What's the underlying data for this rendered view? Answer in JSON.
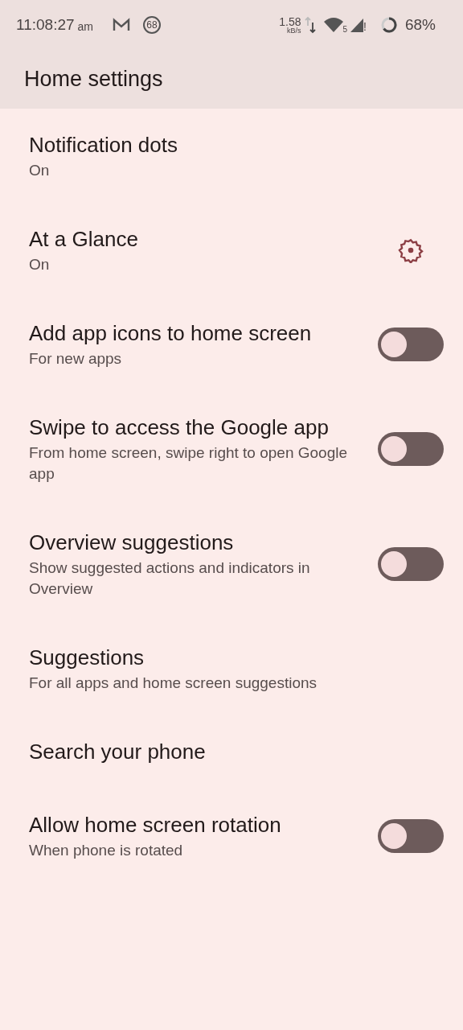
{
  "status_bar": {
    "time": "11:08:27",
    "ampm": "am",
    "notification_count": "68",
    "speed": "1.58",
    "speed_unit": "kB/s",
    "wifi_band": "5",
    "signal_alert": "!",
    "battery": "68%"
  },
  "header": {
    "title": "Home settings"
  },
  "items": [
    {
      "kind": "plain",
      "title": "Notification dots",
      "subtitle": "On"
    },
    {
      "kind": "gear",
      "title": "At a Glance",
      "subtitle": "On"
    },
    {
      "kind": "toggle",
      "title": "Add app icons to home screen",
      "subtitle": "For new apps",
      "on": false
    },
    {
      "kind": "toggle",
      "title": "Swipe to access the Google app",
      "subtitle": "From home screen, swipe right to open Google app",
      "on": false
    },
    {
      "kind": "toggle",
      "title": "Overview suggestions",
      "subtitle": "Show suggested actions and indicators in Overview",
      "on": false
    },
    {
      "kind": "plain",
      "title": "Suggestions",
      "subtitle": "For all apps and home screen suggestions"
    },
    {
      "kind": "plain",
      "title": "Search your phone"
    },
    {
      "kind": "toggle",
      "title": "Allow home screen rotation",
      "subtitle": "When phone is rotated",
      "on": false
    }
  ]
}
